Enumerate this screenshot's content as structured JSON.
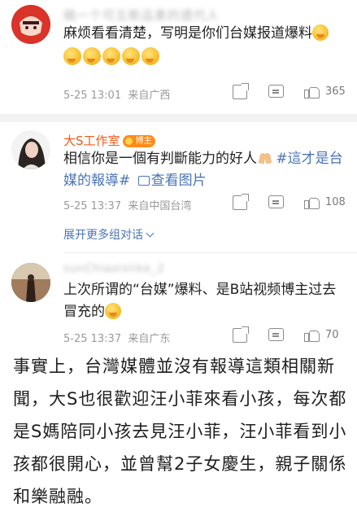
{
  "comments": [
    {
      "username": "稿一个可五断品素的遗代人",
      "text": "麻烦看看清楚，写明是你们台媒报道爆料",
      "time": "5-25 13:01",
      "source": "来自广西",
      "likes": "365"
    },
    {
      "username": "大S工作室",
      "badge": "博主",
      "text_main": "相信你是一個有判斷能力的好人",
      "hashtag": "#這才是台媒的報導#",
      "view_images": "查看图片",
      "time": "5-25 13:37",
      "source": "来自中国台湾",
      "likes": "108",
      "expand_label": "展开更多组对话"
    },
    {
      "username": "sunChiaolxlike_2",
      "text": "上次所谓的“台媒”爆料、是B站视频博主过去冒充的",
      "time": "5-25 13:37",
      "source": "来自广东",
      "likes": "70"
    }
  ],
  "caption": "事實上，台灣媒體並沒有報導這類相關新聞，大S也很歡迎汪小菲來看小孩，每次都是S媽陪同小孩去見汪小菲，汪小菲看到小孩都很開心，並曾幫2子女慶生，親子關係和樂融融。",
  "colors": {
    "link": "#4a74b6",
    "vip_name": "#f05a1a",
    "badge": "#ff8c1a",
    "meta": "#9a9a9a"
  },
  "icons": [
    "share-icon",
    "comment-icon",
    "like-icon",
    "image-icon",
    "chevron-down-icon"
  ]
}
